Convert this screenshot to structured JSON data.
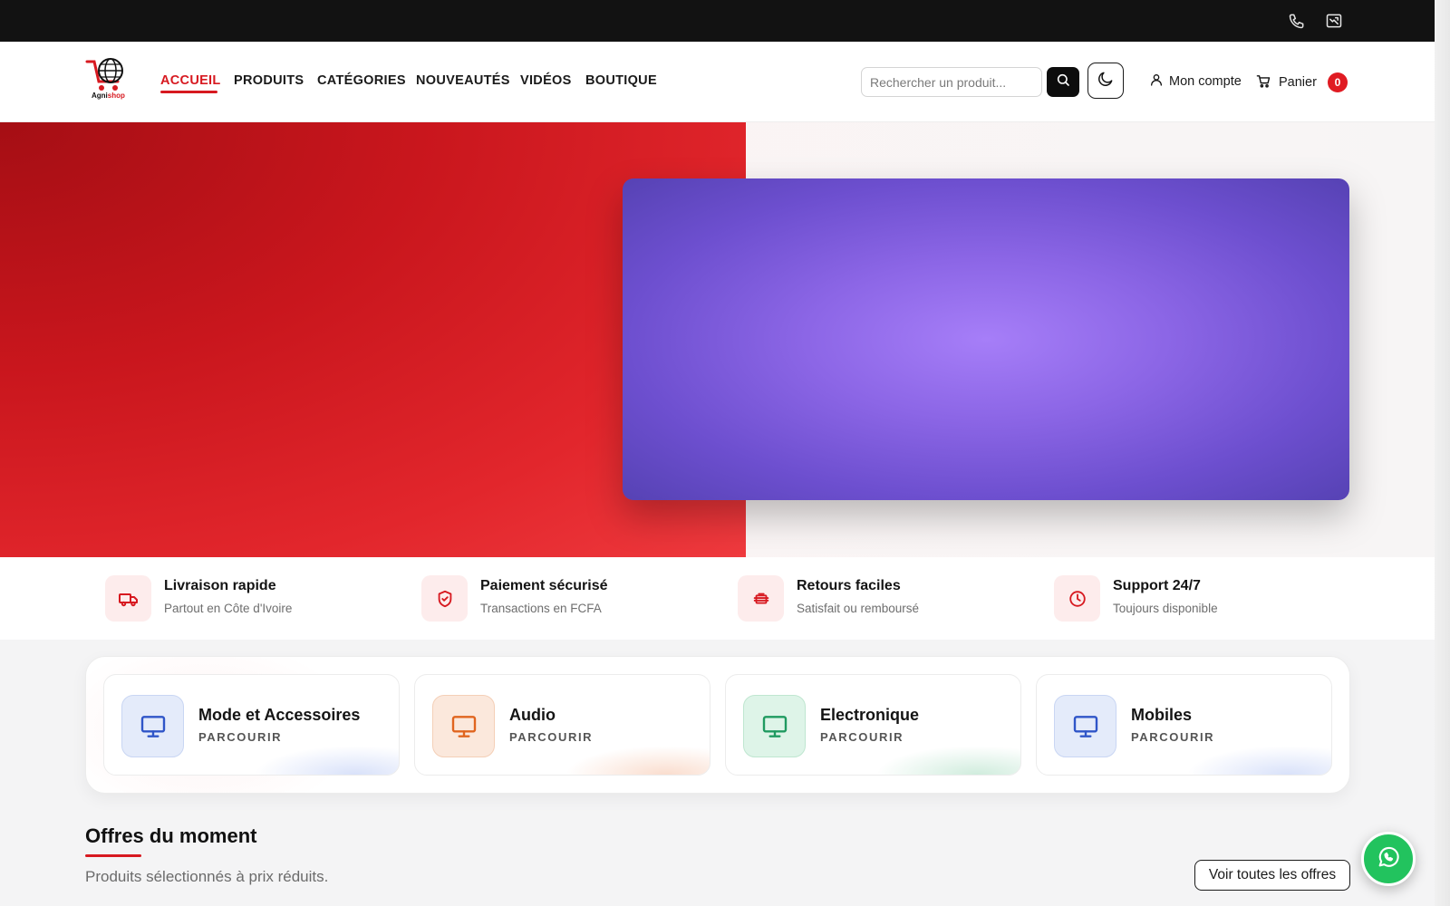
{
  "brand": {
    "name_part1": "Agni",
    "name_part2": "shop",
    "logo_icon": "cart-globe-logo"
  },
  "topbar": {
    "icons": [
      "phone-icon",
      "mail-icon"
    ]
  },
  "nav": {
    "items": [
      {
        "label": "ACCUEIL",
        "active": true
      },
      {
        "label": "PRODUITS"
      },
      {
        "label": "CATÉGORIES"
      },
      {
        "label": "NOUVEAUTÉS"
      },
      {
        "label": "VIDÉOS"
      },
      {
        "label": "BOUTIQUE"
      }
    ]
  },
  "search": {
    "placeholder": "Rechercher un produit..."
  },
  "account": {
    "label": "Mon compte"
  },
  "cart": {
    "label": "Panier",
    "count": "0"
  },
  "features": [
    {
      "icon": "truck-icon",
      "title": "Livraison rapide",
      "subtitle": "Partout en Côte d'Ivoire"
    },
    {
      "icon": "shield-check-icon",
      "title": "Paiement sécurisé",
      "subtitle": "Transactions en FCFA"
    },
    {
      "icon": "return-box-icon",
      "title": "Retours faciles",
      "subtitle": "Satisfait ou remboursé"
    },
    {
      "icon": "clock-icon",
      "title": "Support 24/7",
      "subtitle": "Toujours disponible"
    }
  ],
  "categories": [
    {
      "title": "Mode et Accessoires",
      "cta": "PARCOURIR",
      "icon": "monitor-icon",
      "color": "#2f55c8"
    },
    {
      "title": "Audio",
      "cta": "PARCOURIR",
      "icon": "monitor-icon",
      "color": "#e0651f"
    },
    {
      "title": "Electronique",
      "cta": "PARCOURIR",
      "icon": "monitor-icon",
      "color": "#1f9a60"
    },
    {
      "title": "Mobiles",
      "cta": "PARCOURIR",
      "icon": "monitor-icon",
      "color": "#2f55c8"
    }
  ],
  "offers": {
    "title": "Offres du moment",
    "subtitle": "Produits sélectionnés à prix réduits.",
    "button": "Voir toutes les offres"
  },
  "colors": {
    "accent": "#d71920",
    "hero_red": "#e2262c",
    "hero_purple": "#8c66e6",
    "whatsapp": "#22c35e"
  }
}
